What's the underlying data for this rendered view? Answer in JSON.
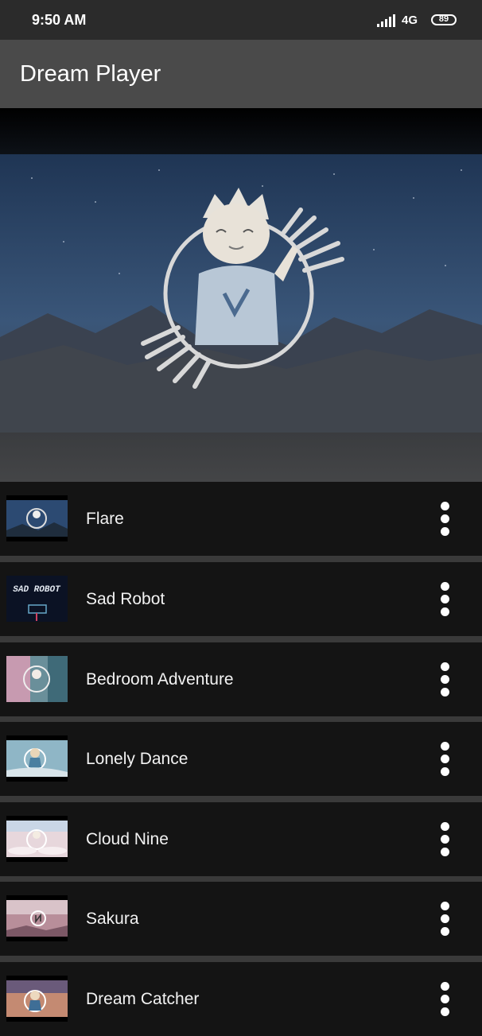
{
  "status_bar": {
    "time": "9:50 AM",
    "network": "4G",
    "battery": "89",
    "icons": [
      "signal-icon",
      "battery-icon"
    ]
  },
  "app_bar": {
    "title": "Dream Player"
  },
  "hero": {
    "image": "album-art-character-icon"
  },
  "songs": [
    {
      "title": "Flare",
      "thumb": "flare-thumbnail"
    },
    {
      "title": "Sad Robot",
      "thumb": "sad-robot-thumbnail",
      "thumb_text": "SAD ROBOT"
    },
    {
      "title": "Bedroom Adventure",
      "thumb": "bedroom-adventure-thumbnail"
    },
    {
      "title": "Lonely Dance",
      "thumb": "lonely-dance-thumbnail"
    },
    {
      "title": "Cloud Nine",
      "thumb": "cloud-nine-thumbnail"
    },
    {
      "title": "Sakura",
      "thumb": "sakura-thumbnail"
    },
    {
      "title": "Dream Catcher",
      "thumb": "dream-catcher-thumbnail"
    }
  ],
  "colors": {
    "status_bar": "#2b2b2b",
    "app_bar": "#4a4a4a",
    "list_item": "#141414",
    "divider": "#3a3a3a",
    "text": "#f2f2f2"
  }
}
